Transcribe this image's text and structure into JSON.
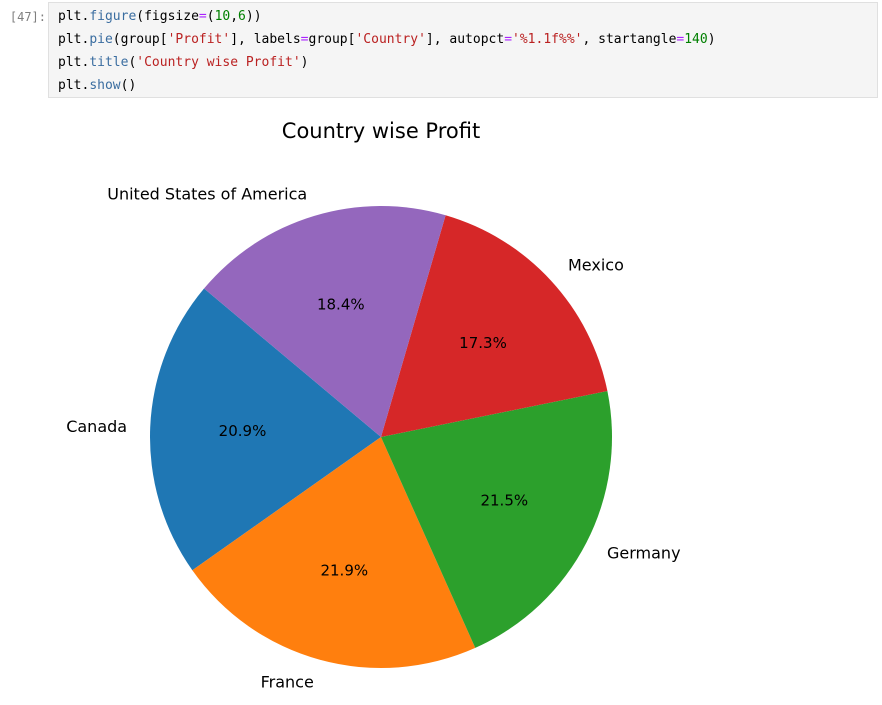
{
  "cell": {
    "prompt": "[47]:",
    "code_lines": [
      [
        {
          "t": "plt.",
          "c": ""
        },
        {
          "t": "figure",
          "c": "kw"
        },
        {
          "t": "(figsize",
          "c": ""
        },
        {
          "t": "=",
          "c": "op"
        },
        {
          "t": "(",
          "c": ""
        },
        {
          "t": "10",
          "c": "num"
        },
        {
          "t": ",",
          "c": ""
        },
        {
          "t": "6",
          "c": "num"
        },
        {
          "t": "))",
          "c": ""
        }
      ],
      [
        {
          "t": "plt.",
          "c": ""
        },
        {
          "t": "pie",
          "c": "kw"
        },
        {
          "t": "(group[",
          "c": ""
        },
        {
          "t": "'Profit'",
          "c": "str"
        },
        {
          "t": "], labels",
          "c": ""
        },
        {
          "t": "=",
          "c": "op"
        },
        {
          "t": "group[",
          "c": ""
        },
        {
          "t": "'Country'",
          "c": "str"
        },
        {
          "t": "], autopct",
          "c": ""
        },
        {
          "t": "=",
          "c": "op"
        },
        {
          "t": "'%1.1f%%'",
          "c": "str"
        },
        {
          "t": ", startangle",
          "c": ""
        },
        {
          "t": "=",
          "c": "op"
        },
        {
          "t": "140",
          "c": "num"
        },
        {
          "t": ")",
          "c": ""
        }
      ],
      [
        {
          "t": "plt.",
          "c": ""
        },
        {
          "t": "title",
          "c": "kw"
        },
        {
          "t": "(",
          "c": ""
        },
        {
          "t": "'Country wise Profit'",
          "c": "str"
        },
        {
          "t": ")",
          "c": ""
        }
      ],
      [
        {
          "t": "plt.",
          "c": ""
        },
        {
          "t": "show",
          "c": "kw"
        },
        {
          "t": "()",
          "c": ""
        }
      ]
    ]
  },
  "chart_data": {
    "type": "pie",
    "title": "Country wise Profit",
    "start_angle_deg": 140,
    "direction": "counterclockwise",
    "slices": [
      {
        "label": "Canada",
        "pct": 20.9,
        "pct_label": "20.9%",
        "color": "#1f77b4"
      },
      {
        "label": "France",
        "pct": 21.9,
        "pct_label": "21.9%",
        "color": "#ff7f0e"
      },
      {
        "label": "Germany",
        "pct": 21.5,
        "pct_label": "21.5%",
        "color": "#2ca02c"
      },
      {
        "label": "Mexico",
        "pct": 17.3,
        "pct_label": "17.3%",
        "color": "#d62728"
      },
      {
        "label": "United States of America",
        "pct": 18.4,
        "pct_label": "18.4%",
        "color": "#9467bd"
      }
    ]
  }
}
